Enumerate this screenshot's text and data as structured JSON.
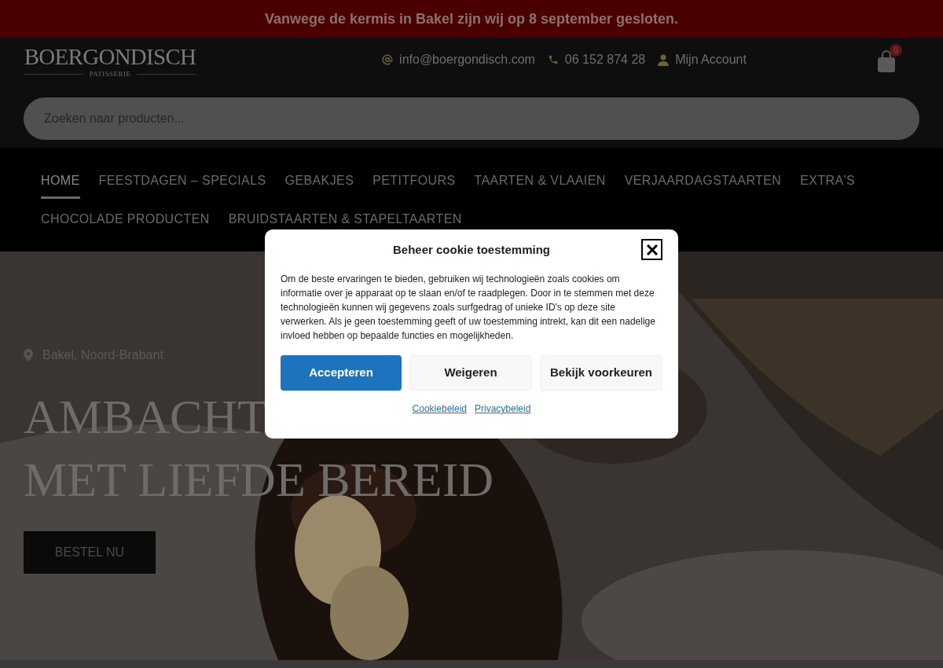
{
  "notice": "Vanwege de kermis in Bakel zijn wij op 8 september gesloten.",
  "logo": {
    "name": "BOERGONDISCH",
    "tagline": "PATISSERIE"
  },
  "contacts": [
    {
      "kind": "email",
      "text": "info@boergondisch.com"
    },
    {
      "kind": "phone",
      "text": "06 152 874 28"
    },
    {
      "kind": "account",
      "text": "Mijn Account"
    }
  ],
  "cart": {
    "count": "0"
  },
  "search": {
    "placeholder": "Zoeken naar producten..."
  },
  "nav": [
    {
      "label": "HOME",
      "selected": true
    },
    {
      "label": "FEESTDAGEN – SPECIALS",
      "selected": false
    },
    {
      "label": "GEBAKJES",
      "selected": false
    },
    {
      "label": "PETITFOURS",
      "selected": false
    },
    {
      "label": "TAARTEN & VLAAIEN",
      "selected": false
    },
    {
      "label": "VERJAARDAGSTAARTEN",
      "selected": false
    },
    {
      "label": "EXTRA'S",
      "selected": false
    },
    {
      "label": "CHOCOLADE PRODUCTEN",
      "selected": false
    },
    {
      "label": "BRUIDSTAARTEN & STAPELTAARTEN",
      "selected": false
    }
  ],
  "hero": {
    "location": "Bakel, Noord-Brabant",
    "heading_lines": [
      "AMBACHT",
      "MET LIEFDE BEREID"
    ],
    "button": "BESTEL NU"
  },
  "cookie_dialog": {
    "title": "Beheer cookie toestemming",
    "body": "Om de beste ervaringen te bieden, gebruiken wij technologieën zoals cookies om informatie over je apparaat op te slaan en/of te raadplegen. Door in te stemmen met deze technologieën kunnen wij gegevens zoals surfgedrag of unieke ID's op deze site verwerken. Als je geen toestemming geeft of uw toestemming intrekt, kan dit een nadelige invloed hebben op bepaalde functies en mogelijkheden.",
    "buttons": [
      {
        "kind": "primary",
        "label": "Accepteren"
      },
      {
        "kind": "secondary",
        "label": "Weigeren"
      },
      {
        "kind": "secondary",
        "label": "Bekijk voorkeuren"
      }
    ],
    "links": [
      "Cookiebeleid",
      "Privacybeleid"
    ]
  }
}
